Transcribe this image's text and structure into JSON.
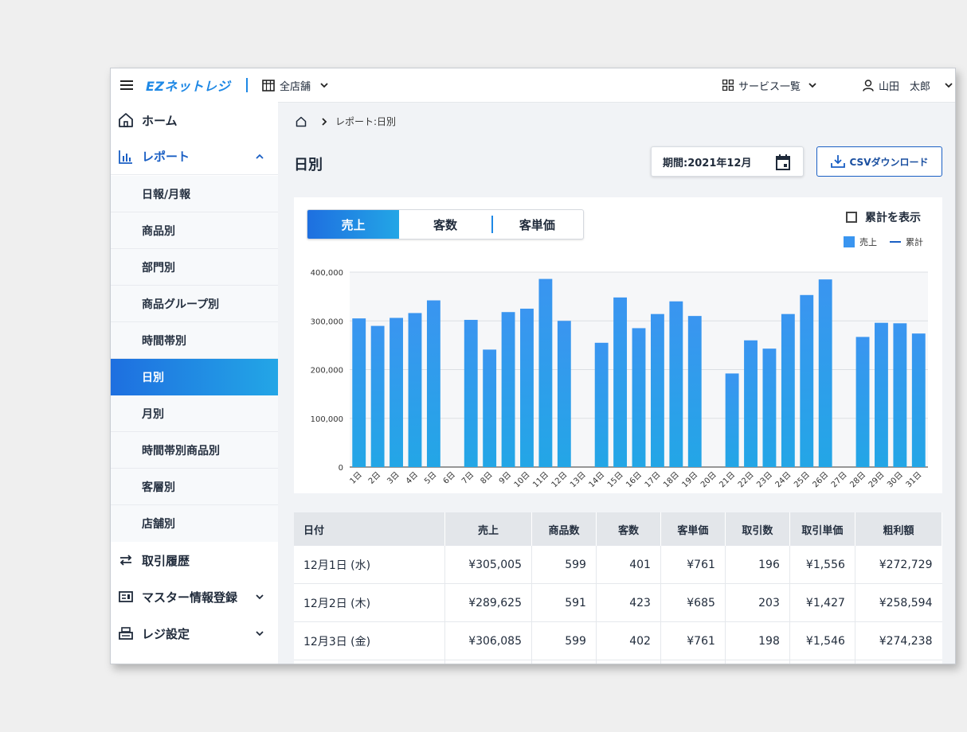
{
  "header": {
    "logo": "EZネットレジ",
    "store": "全店舗",
    "services": "サービス一覧",
    "user": "山田　太郎"
  },
  "sidebar": {
    "home": "ホーム",
    "report": "レポート",
    "sub_items": [
      "日報/月報",
      "商品別",
      "部門別",
      "商品グループ別",
      "時間帯別",
      "日別",
      "月別",
      "時間帯別商品別",
      "客層別",
      "店舗別"
    ],
    "active_sub": "日別",
    "history": "取引履歴",
    "master": "マスター情報登録",
    "register": "レジ設定"
  },
  "breadcrumb": {
    "label": "レポート:日別"
  },
  "page": {
    "title": "日別",
    "period": "期間:2021年12月",
    "csv": "CSVダウンロード"
  },
  "tabs": [
    "売上",
    "客数",
    "客単価"
  ],
  "cumulative_label": "累計を表示",
  "legend": {
    "bar": "売上",
    "line": "累計"
  },
  "colors": {
    "accent": "#1e6fe0",
    "bar": "#3a95f0",
    "bar_light": "#23a6e6"
  },
  "chart_data": {
    "type": "bar",
    "categories": [
      "1日",
      "2日",
      "3日",
      "4日",
      "5日",
      "6日",
      "7日",
      "8日",
      "9日",
      "10日",
      "11日",
      "12日",
      "13日",
      "14日",
      "15日",
      "16日",
      "17日",
      "18日",
      "19日",
      "20日",
      "21日",
      "22日",
      "23日",
      "24日",
      "25日",
      "26日",
      "27日",
      "28日",
      "29日",
      "30日",
      "31日"
    ],
    "series": [
      {
        "name": "売上",
        "values": [
          305005,
          289625,
          306085,
          316000,
          342000,
          0,
          302000,
          241000,
          318000,
          325000,
          386000,
          300000,
          0,
          255000,
          348000,
          285000,
          314000,
          340000,
          310000,
          0,
          192000,
          260000,
          243000,
          314000,
          353000,
          385000,
          0,
          267000,
          296000,
          295000,
          274000
        ]
      }
    ],
    "yticks": [
      "400,000",
      "300,000",
      "200,000",
      "100,000",
      "0"
    ],
    "ylim": [
      0,
      400000
    ]
  },
  "table": {
    "headers": [
      "日付",
      "売上",
      "商品数",
      "客数",
      "客単価",
      "取引数",
      "取引単価",
      "粗利額"
    ],
    "rows": [
      [
        "12月1日 (水)",
        "¥305,005",
        "599",
        "401",
        "¥761",
        "196",
        "¥1,556",
        "¥272,729"
      ],
      [
        "12月2日 (木)",
        "¥289,625",
        "591",
        "423",
        "¥685",
        "203",
        "¥1,427",
        "¥258,594"
      ],
      [
        "12月3日 (金)",
        "¥306,085",
        "599",
        "402",
        "¥761",
        "198",
        "¥1,546",
        "¥274,238"
      ]
    ]
  }
}
